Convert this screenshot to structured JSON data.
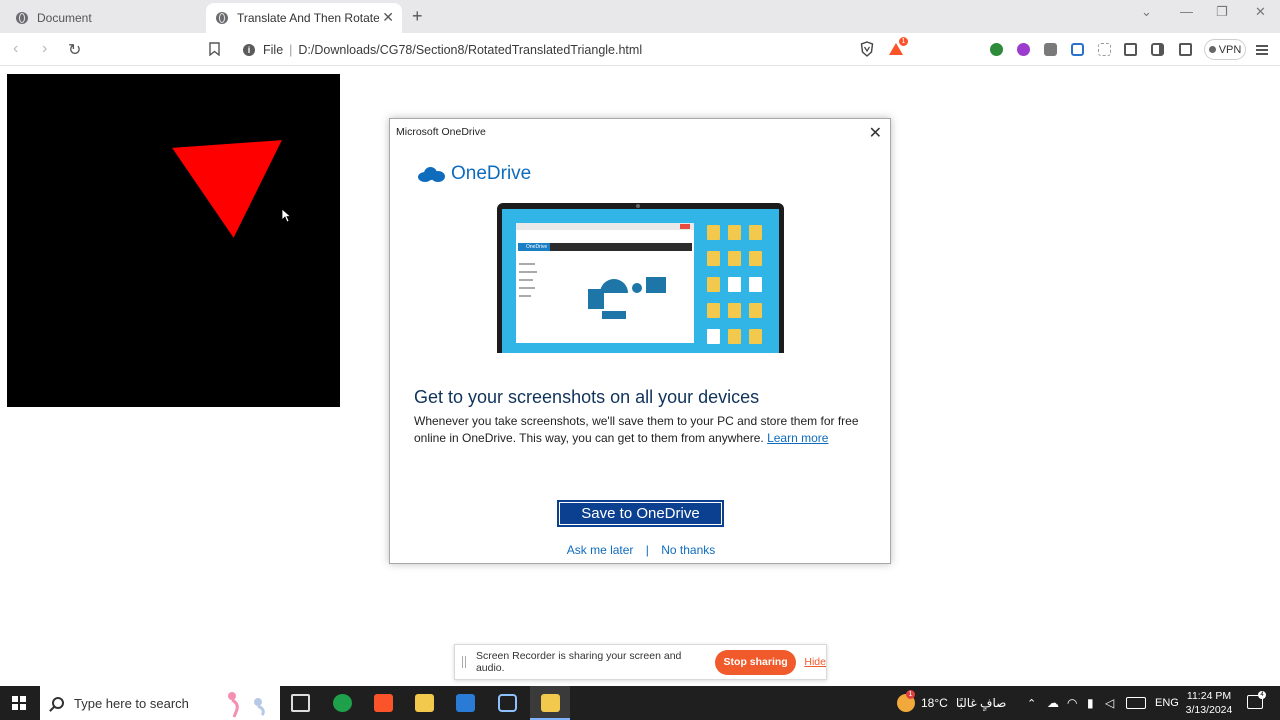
{
  "browser": {
    "tabs": [
      {
        "title": "Document",
        "active": false
      },
      {
        "title": "Translate And Then Rotate A Triangle",
        "active": true
      }
    ],
    "address": {
      "scheme_label": "File",
      "path": "D:/Downloads/CG78/Section8/RotatedTranslatedTriangle.html"
    },
    "vpn_label": "VPN",
    "notification_count": "1",
    "colors": {
      "tabstrip": "#e8e8ea",
      "brave_orange": "#fb542b"
    }
  },
  "page": {
    "canvas_color": "#000000",
    "triangle_color": "#ff0000"
  },
  "dialog": {
    "window_title": "Microsoft OneDrive",
    "logo_text": "OneDrive",
    "preview_sidebar_label": "OneDrive",
    "heading": "Get to your screenshots on all your devices",
    "body": "Whenever you take screenshots, we'll save them to your PC and store them for free online in OneDrive. This way, you can get to them from anywhere.",
    "learn_more": "Learn more",
    "primary_button": "Save to OneDrive",
    "ask_later": "Ask me later",
    "link_separator": "|",
    "no_thanks": "No thanks",
    "colors": {
      "brand_blue": "#0f6cbd",
      "button_blue": "#0b3f8f"
    }
  },
  "share_bar": {
    "message": "Screen Recorder is sharing your screen and audio.",
    "stop_label": "Stop sharing",
    "hide_label": "Hide",
    "accent": "#f15a2b"
  },
  "taskbar": {
    "search_placeholder": "Type here to search",
    "weather_temp": "18°C",
    "weather_desc": "صافٍ غالبًا",
    "weather_badge": "1",
    "language": "ENG",
    "time": "11:24 PM",
    "date": "3/13/2024",
    "notification_badge": "4"
  }
}
